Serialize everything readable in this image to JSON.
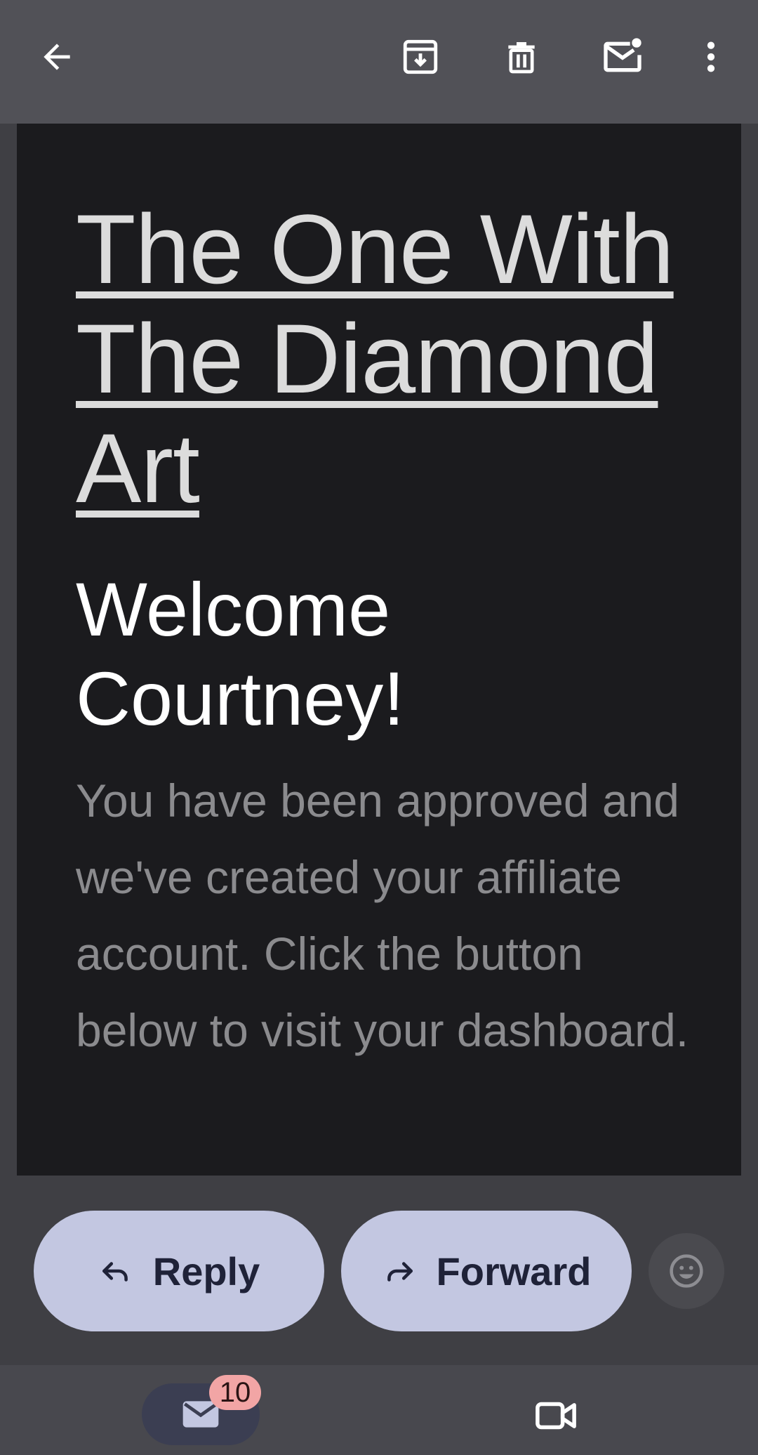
{
  "toolbar": {
    "back_icon": "arrow-left-icon",
    "archive_icon": "archive-icon",
    "delete_icon": "trash-icon",
    "mark_unread_icon": "mail-unread-icon",
    "more_icon": "more-vert-icon"
  },
  "email": {
    "title": "The One With The Diamond Art",
    "greeting": "Welcome Courtney!",
    "body": "You have been approved and we've created your affiliate account. Click the button below to visit your dashboard."
  },
  "actions": {
    "reply_label": "Reply",
    "forward_label": "Forward",
    "reply_icon": "reply-arrow-icon",
    "forward_icon": "forward-arrow-icon",
    "emoji_icon": "emoji-smile-icon"
  },
  "bottom_nav": {
    "mail_icon": "mail-icon",
    "mail_badge": "10",
    "meet_icon": "video-camera-icon"
  },
  "colors": {
    "topbar": "#515157",
    "card": "#1b1b1e",
    "pill": "#c3c7e1",
    "badge": "#f2a5a5"
  }
}
